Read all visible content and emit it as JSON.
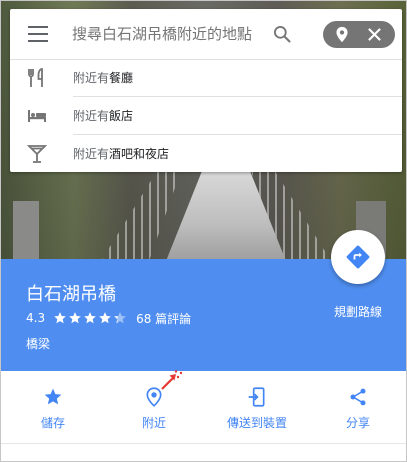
{
  "search": {
    "placeholder": "搜尋白石湖吊橋附近的地點"
  },
  "nearby": [
    {
      "prefix": "附近有",
      "keyword": "餐廳",
      "icon": "restaurant-icon"
    },
    {
      "prefix": "附近有",
      "keyword": "飯店",
      "icon": "hotel-icon"
    },
    {
      "prefix": "附近有",
      "keyword": "酒吧和夜店",
      "icon": "bar-icon"
    }
  ],
  "place": {
    "name": "白石湖吊橋",
    "rating": "4.3",
    "stars": 4.3,
    "reviews": "68 篇評論",
    "category": "橋梁"
  },
  "route": {
    "label": "規劃路線",
    "icon": "directions-icon"
  },
  "actions": [
    {
      "label": "儲存",
      "icon": "star-icon"
    },
    {
      "label": "附近",
      "icon": "nearby-pin-icon"
    },
    {
      "label": "傳送到裝置",
      "icon": "send-to-device-icon"
    },
    {
      "label": "分享",
      "icon": "share-icon"
    }
  ],
  "colors": {
    "accent": "#4285f4",
    "panel": "#4f8ef0",
    "pill": "#757575"
  }
}
